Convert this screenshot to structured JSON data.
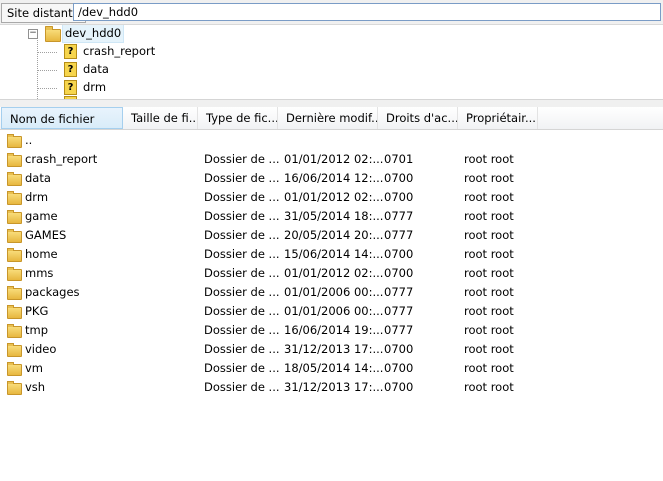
{
  "path_bar": {
    "label": "Site distant :",
    "value": "/dev_hdd0"
  },
  "tree": {
    "root": {
      "label": "dev_hdd0",
      "expander": "−"
    },
    "children": [
      {
        "label": "crash_report"
      },
      {
        "label": "data"
      },
      {
        "label": "drm"
      }
    ]
  },
  "columns": [
    "Nom de fichier",
    "Taille de fi...",
    "Type de fic...",
    "Dernière modif...",
    "Droits d'ac...",
    "Propriétair..."
  ],
  "parent_entry": "..",
  "files": [
    {
      "name": "crash_report",
      "type": "Dossier de ...",
      "modified": "01/01/2012 02:...",
      "perms": "0701",
      "owner": "root root"
    },
    {
      "name": "data",
      "type": "Dossier de ...",
      "modified": "16/06/2014 12:...",
      "perms": "0700",
      "owner": "root root"
    },
    {
      "name": "drm",
      "type": "Dossier de ...",
      "modified": "01/01/2012 02:...",
      "perms": "0700",
      "owner": "root root"
    },
    {
      "name": "game",
      "type": "Dossier de ...",
      "modified": "31/05/2014 18:...",
      "perms": "0777",
      "owner": "root root"
    },
    {
      "name": "GAMES",
      "type": "Dossier de ...",
      "modified": "20/05/2014 20:...",
      "perms": "0777",
      "owner": "root root"
    },
    {
      "name": "home",
      "type": "Dossier de ...",
      "modified": "15/06/2014 14:...",
      "perms": "0700",
      "owner": "root root"
    },
    {
      "name": "mms",
      "type": "Dossier de ...",
      "modified": "01/01/2012 02:...",
      "perms": "0700",
      "owner": "root root"
    },
    {
      "name": "packages",
      "type": "Dossier de ...",
      "modified": "01/01/2006 00:...",
      "perms": "0777",
      "owner": "root root"
    },
    {
      "name": "PKG",
      "type": "Dossier de ...",
      "modified": "01/01/2006 00:...",
      "perms": "0777",
      "owner": "root root"
    },
    {
      "name": "tmp",
      "type": "Dossier de ...",
      "modified": "16/06/2014 19:...",
      "perms": "0777",
      "owner": "root root"
    },
    {
      "name": "video",
      "type": "Dossier de ...",
      "modified": "31/12/2013 17:...",
      "perms": "0700",
      "owner": "root root"
    },
    {
      "name": "vm",
      "type": "Dossier de ...",
      "modified": "18/05/2014 14:...",
      "perms": "0700",
      "owner": "root root"
    },
    {
      "name": "vsh",
      "type": "Dossier de ...",
      "modified": "31/12/2013 17:...",
      "perms": "0700",
      "owner": "root root"
    }
  ]
}
